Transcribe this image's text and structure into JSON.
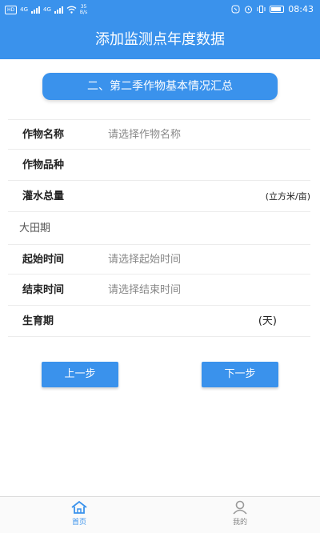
{
  "status_bar": {
    "badge": "HD",
    "signal_1": "4G",
    "signal_2": "4G",
    "net_speed_value": "35",
    "net_speed_unit": "B/s",
    "time": "08:43"
  },
  "header": {
    "title": "添加监测点年度数据"
  },
  "section": {
    "title": "二、第二季作物基本情况汇总"
  },
  "form": {
    "crop_name": {
      "label": "作物名称",
      "placeholder": "请选择作物名称"
    },
    "crop_variety": {
      "label": "作物品种",
      "value": ""
    },
    "irrigation": {
      "label": "灌水总量",
      "unit": "(立方米/亩)",
      "value": ""
    },
    "field_period": {
      "header": "大田期"
    },
    "start_time": {
      "label": "起始时间",
      "placeholder": "请选择起始时间"
    },
    "end_time": {
      "label": "结束时间",
      "placeholder": "请选择结束时间"
    },
    "growth_period": {
      "label": "生育期",
      "unit": "(天)",
      "value": ""
    }
  },
  "buttons": {
    "prev": "上一步",
    "next": "下一步"
  },
  "tabbar": {
    "home": {
      "label": "首页",
      "icon": "home-icon",
      "active": true
    },
    "mine": {
      "label": "我的",
      "icon": "user-icon",
      "active": false
    }
  },
  "colors": {
    "primary": "#3a92ec",
    "divider": "#ececec",
    "placeholder": "#888888"
  }
}
